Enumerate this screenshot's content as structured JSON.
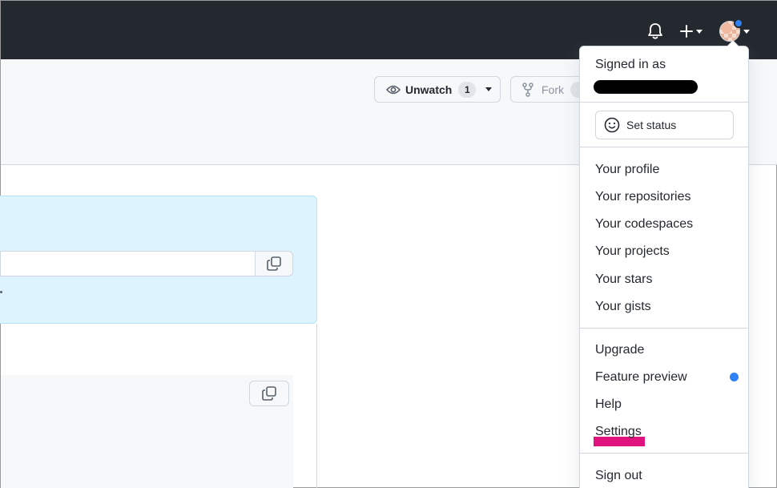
{
  "header": {
    "icons": [
      "bell-icon",
      "plus-icon",
      "avatar"
    ],
    "notification_dot_color": "#2f81f7"
  },
  "repo_header": {
    "unwatch_label": "Unwatch",
    "unwatch_count": "1",
    "fork_label": "Fork"
  },
  "dropdown": {
    "signed_in_label": "Signed in as",
    "set_status_label": "Set status",
    "items": {
      "your_profile": "Your profile",
      "your_repositories": "Your repositories",
      "your_codespaces": "Your codespaces",
      "your_projects": "Your projects",
      "your_stars": "Your stars",
      "your_gists": "Your gists",
      "upgrade": "Upgrade",
      "feature_preview": "Feature preview",
      "help": "Help",
      "settings": "Settings",
      "sign_out": "Sign out"
    },
    "highlight_color": "#e0137f"
  }
}
